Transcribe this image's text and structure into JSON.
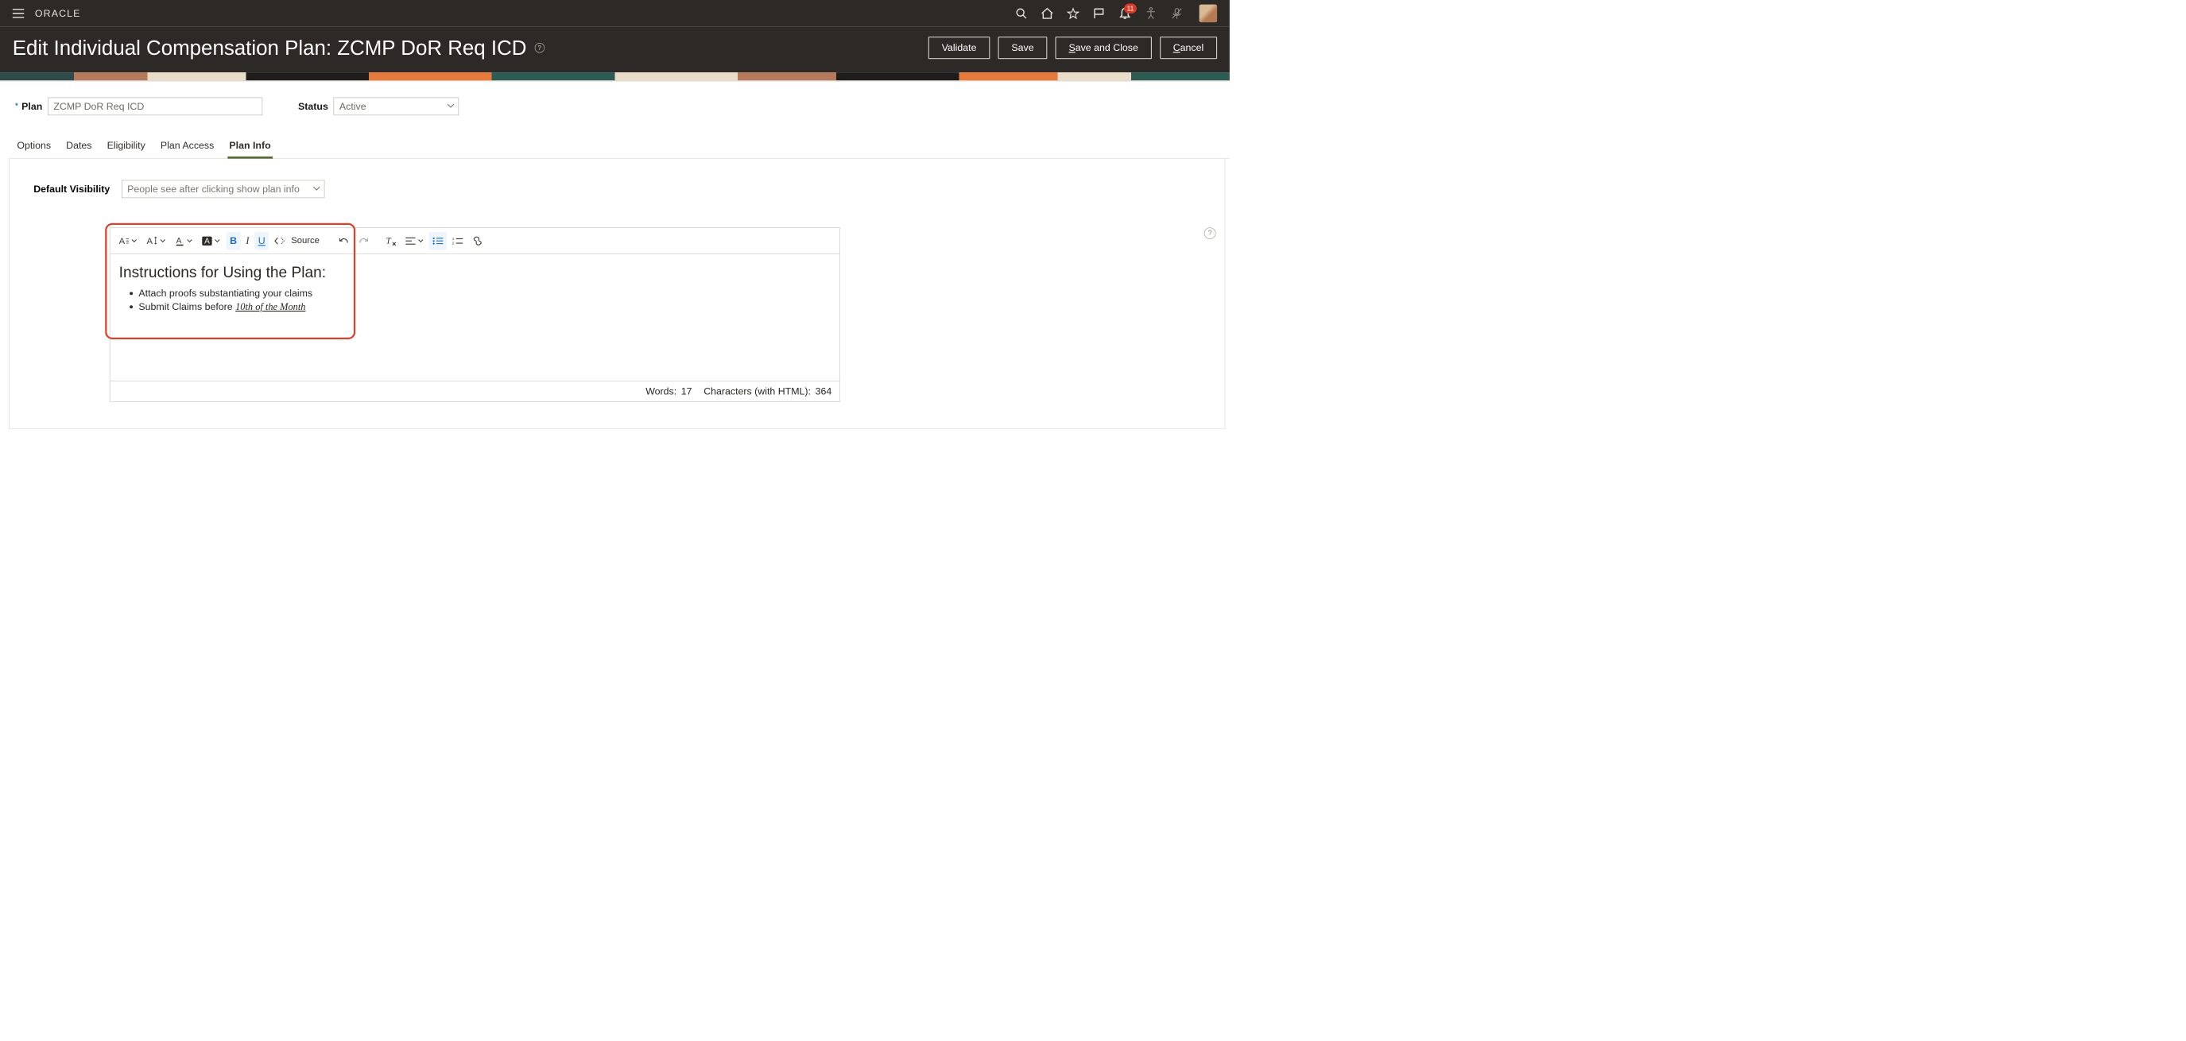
{
  "brand": "ORACLE",
  "notification_count": "11",
  "page_title": "Edit Individual Compensation Plan: ZCMP DoR Req ICD",
  "actions": {
    "validate": "Validate",
    "save": "Save",
    "save_close_pre": "S",
    "save_close_post": "ave and Close",
    "cancel_pre": "C",
    "cancel_post": "ancel"
  },
  "form": {
    "plan_label": "Plan",
    "plan_value": "ZCMP DoR Req ICD",
    "status_label": "Status",
    "status_value": "Active"
  },
  "tabs": [
    "Options",
    "Dates",
    "Eligibility",
    "Plan Access",
    "Plan Info"
  ],
  "active_tab_index": 4,
  "plan_info": {
    "default_visibility_label": "Default Visibility",
    "default_visibility_value": "People see after clicking show plan info"
  },
  "editor": {
    "source_label": "Source",
    "heading": "Instructions for Using the Plan:",
    "bullets": {
      "b1": "Attach proofs substantiating your claims",
      "b2_pre": "Submit Claims before ",
      "b2_em": "10th of the Month"
    },
    "status": {
      "words_label": "Words:",
      "words_count": "17",
      "chars_label": "Characters (with HTML):",
      "chars_count": "364"
    }
  }
}
